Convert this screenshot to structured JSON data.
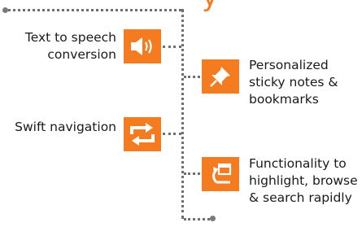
{
  "title_fragment": "y",
  "features_left": [
    {
      "label_line1": "Text to speech",
      "label_line2": "conversion",
      "icon": "speaker-icon"
    },
    {
      "label_line1": "Swift navigation",
      "icon": "swap-arrows-icon"
    }
  ],
  "features_right": [
    {
      "label_lines": [
        "Personalized",
        "sticky notes &",
        "bookmarks"
      ],
      "icon": "pushpin-icon"
    },
    {
      "label_lines": [
        "Functionality to",
        "highlight, browse",
        "& search rapidly"
      ],
      "icon": "highlight-search-icon"
    }
  ],
  "colors": {
    "accent": "#f47b20",
    "connector": "#6f6f6f",
    "text": "#1a1a1a"
  }
}
